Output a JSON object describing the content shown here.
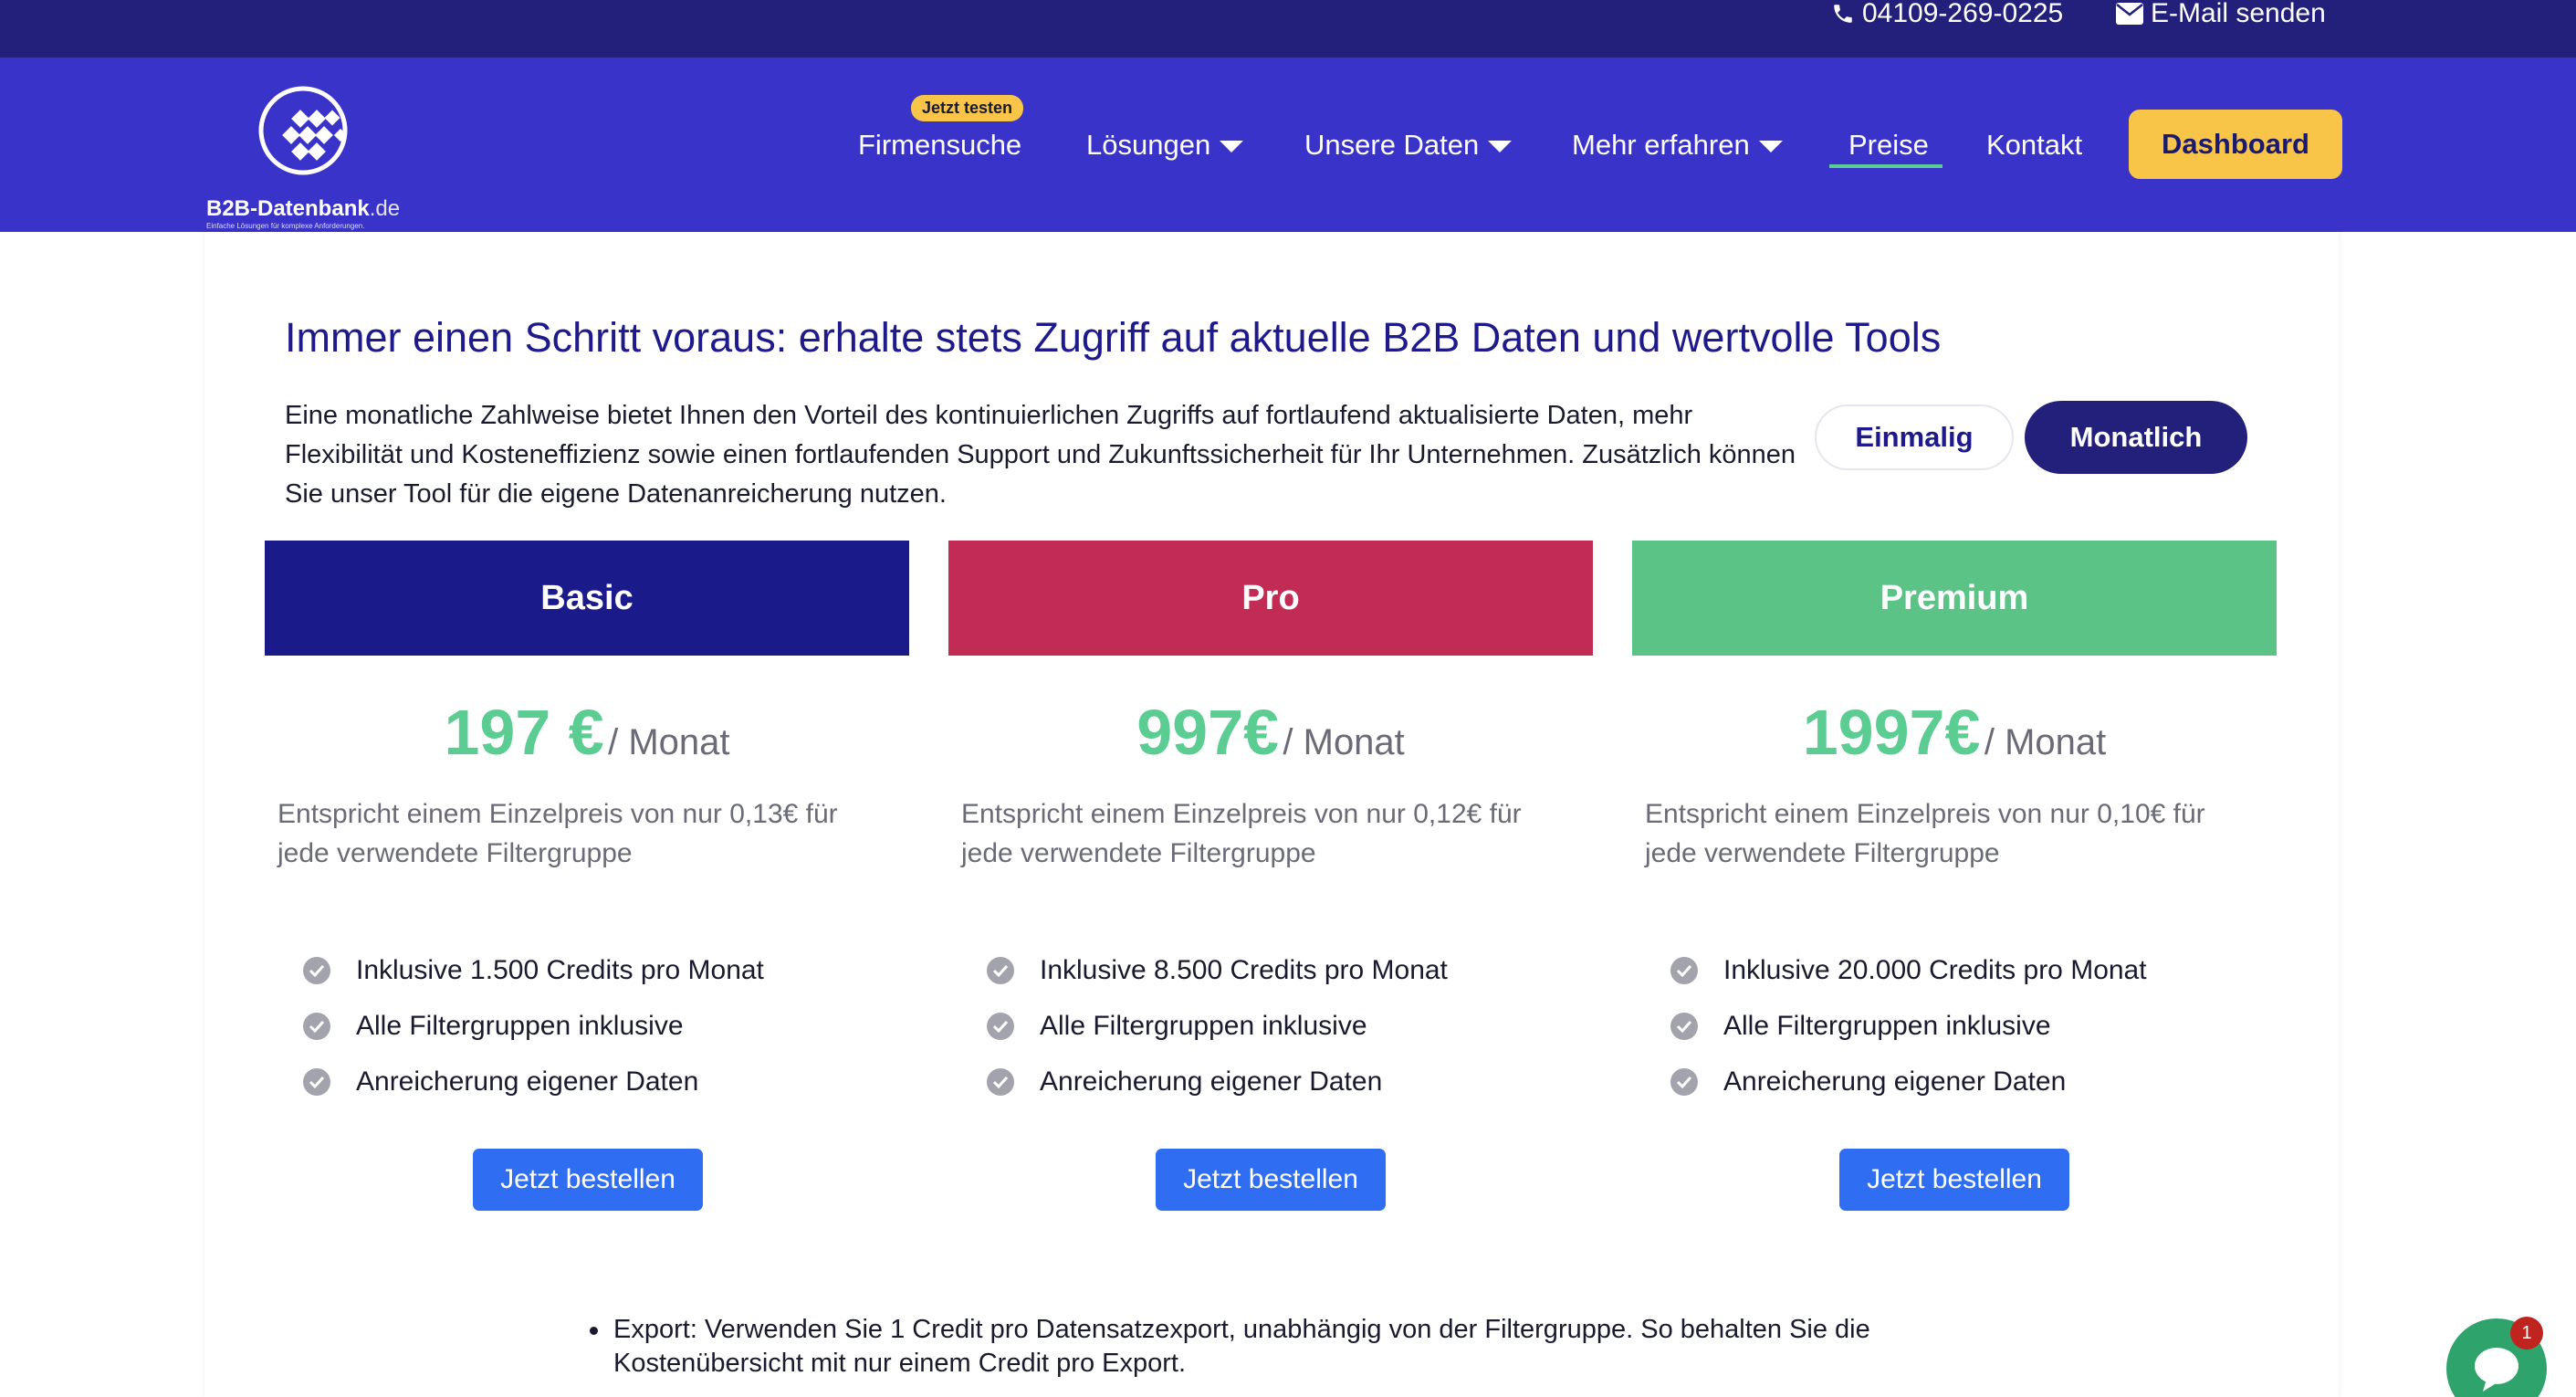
{
  "topbar": {
    "phone": "04109-269-0225",
    "email": "E-Mail senden"
  },
  "logo": {
    "name": "B2B-Datenbank",
    "tld": ".de",
    "tagline": "Einfache Lösungen für komplexe Anforderungen."
  },
  "nav": {
    "badge": "Jetzt testen",
    "items": [
      {
        "label": "Firmensuche"
      },
      {
        "label": "Lösungen"
      },
      {
        "label": "Unsere Daten"
      },
      {
        "label": "Mehr erfahren"
      },
      {
        "label": "Preise",
        "active": true
      },
      {
        "label": "Kontakt"
      }
    ],
    "dashboard": "Dashboard"
  },
  "pricing": {
    "headline": "Immer einen Schritt voraus: erhalte stets Zugriff auf aktuelle B2B Daten und wertvolle Tools",
    "intro": "Eine monatliche Zahlweise bietet Ihnen den Vorteil des kontinuierlichen Zugriffs auf fortlaufend aktualisierte Daten, mehr Flexibilität und Kosteneffizienz sowie einen fortlaufenden Support und Zukunftssicherheit für Ihr Unternehmen. Zusätzlich können Sie unser Tool für die eigene Datenanreicherung nutzen.",
    "toggle": {
      "once": "Einmalig",
      "monthly": "Monatlich",
      "selected": "Monatlich"
    },
    "plans": [
      {
        "name": "Basic",
        "color": "#1b1a8a",
        "price": "197 €",
        "per": "/ Monat",
        "desc": "Entspricht einem Einzelpreis von nur 0,13€ für jede verwendete Filtergruppe",
        "features": [
          "Inklusive 1.500 Credits pro Monat",
          "Alle Filtergruppen inklusive",
          "Anreicherung eigener Daten"
        ],
        "cta": "Jetzt bestellen"
      },
      {
        "name": "Pro",
        "color": "#c22c54",
        "price": "997€",
        "per": "/ Monat",
        "desc": "Entspricht einem Einzelpreis von nur 0,12€ für jede verwendete Filtergruppe",
        "features": [
          "Inklusive 8.500 Credits pro Monat",
          "Alle Filtergruppen inklusive",
          "Anreicherung eigener Daten"
        ],
        "cta": "Jetzt bestellen"
      },
      {
        "name": "Premium",
        "color": "#5cc387",
        "price": "1997€",
        "per": "/ Monat",
        "desc": "Entspricht einem Einzelpreis von nur 0,10€ für jede verwendete Filtergruppe",
        "features": [
          "Inklusive 20.000 Credits pro Monat",
          "Alle Filtergruppen inklusive",
          "Anreicherung eigener Daten"
        ],
        "cta": "Jetzt bestellen"
      }
    ],
    "bullet": "Export: Verwenden Sie 1 Credit pro Datensatzexport, unabhängig von der Filtergruppe. So behalten Sie die Kostenübersicht mit nur einem Credit pro Export."
  },
  "chat": {
    "unread": "1"
  },
  "colors": {
    "accent_green": "#5ccd92",
    "nav_bg": "#3a33c9",
    "topbar_bg": "#22207a",
    "cta_blue": "#2f6ef2",
    "yellow": "#f9c548"
  },
  "icons": [
    "phone-icon",
    "envelope-icon",
    "check-circle-icon",
    "chevron-down-icon",
    "chat-bubble-icon"
  ]
}
